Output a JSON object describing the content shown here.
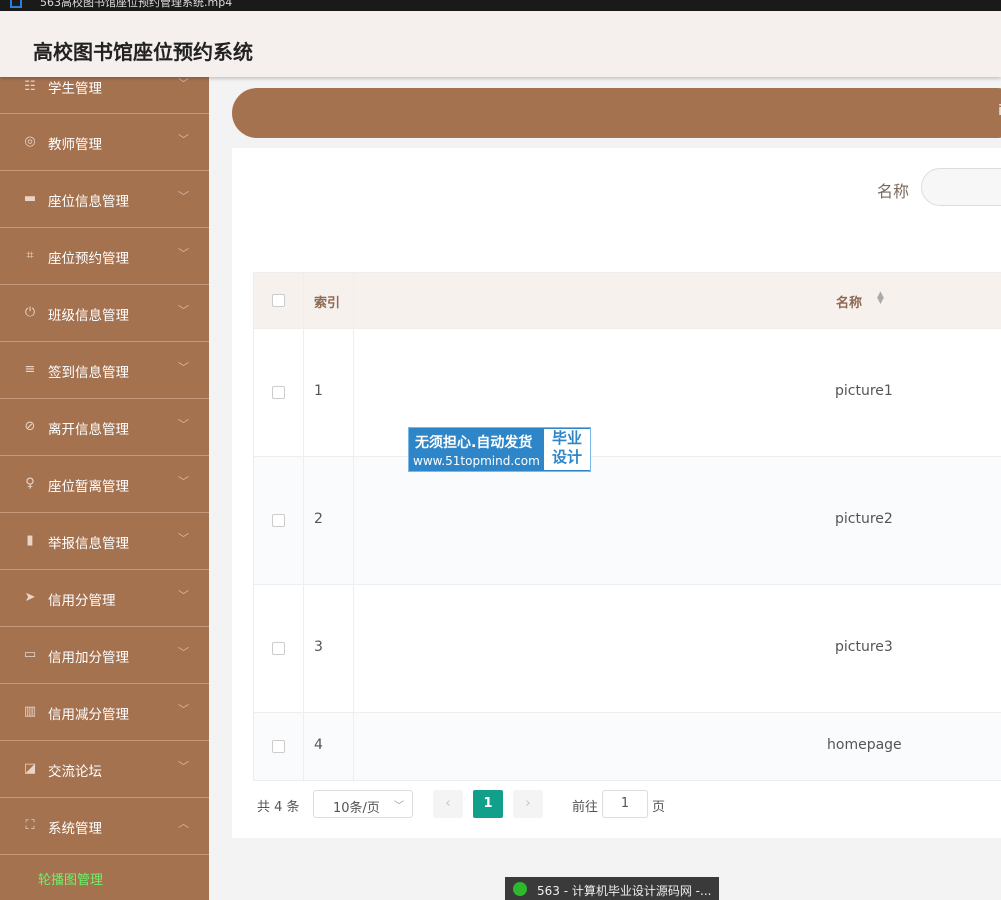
{
  "window": {
    "title": "563高校图书馆座位预约管理系统.mp4"
  },
  "header": {
    "title": "高校图书馆座位预约系统"
  },
  "sidebar": {
    "items": [
      {
        "label": "学生管理",
        "icon": "user-icon"
      },
      {
        "label": "教师管理",
        "icon": "compass-icon"
      },
      {
        "label": "座位信息管理",
        "icon": "monitor-icon"
      },
      {
        "label": "座位预约管理",
        "icon": "crop-icon"
      },
      {
        "label": "班级信息管理",
        "icon": "power-icon"
      },
      {
        "label": "签到信息管理",
        "icon": "list-icon"
      },
      {
        "label": "离开信息管理",
        "icon": "bell-off-icon"
      },
      {
        "label": "座位暂离管理",
        "icon": "microphone-icon"
      },
      {
        "label": "举报信息管理",
        "icon": "bar-icon"
      },
      {
        "label": "信用分管理",
        "icon": "send-icon"
      },
      {
        "label": "信用加分管理",
        "icon": "message-icon"
      },
      {
        "label": "信用减分管理",
        "icon": "chart-icon"
      },
      {
        "label": "交流论坛",
        "icon": "chat-icon"
      },
      {
        "label": "系统管理",
        "icon": "expand-icon"
      }
    ],
    "submenu": [
      {
        "label": "轮播图管理"
      }
    ]
  },
  "banner": {
    "text": "i"
  },
  "search": {
    "label": "名称"
  },
  "table": {
    "columns": {
      "index": "索引",
      "name": "名称"
    },
    "rows": [
      {
        "index": "1",
        "name": "picture1"
      },
      {
        "index": "2",
        "name": "picture2"
      },
      {
        "index": "3",
        "name": "picture3"
      },
      {
        "index": "4",
        "name": "homepage"
      }
    ]
  },
  "pagination": {
    "total": "共 4 条",
    "page_size": "10条/页",
    "prev": "‹",
    "current": "1",
    "next": "›",
    "goto_label": "前往",
    "goto_value": "1",
    "page_unit": "页"
  },
  "watermark": {
    "line1": "无须担心.自动发货",
    "line2": "www.51topmind.com",
    "badge1": "毕业",
    "badge2": "设计"
  },
  "taskbar": {
    "text": "563 - 计算机毕业设计源码网 -..."
  }
}
